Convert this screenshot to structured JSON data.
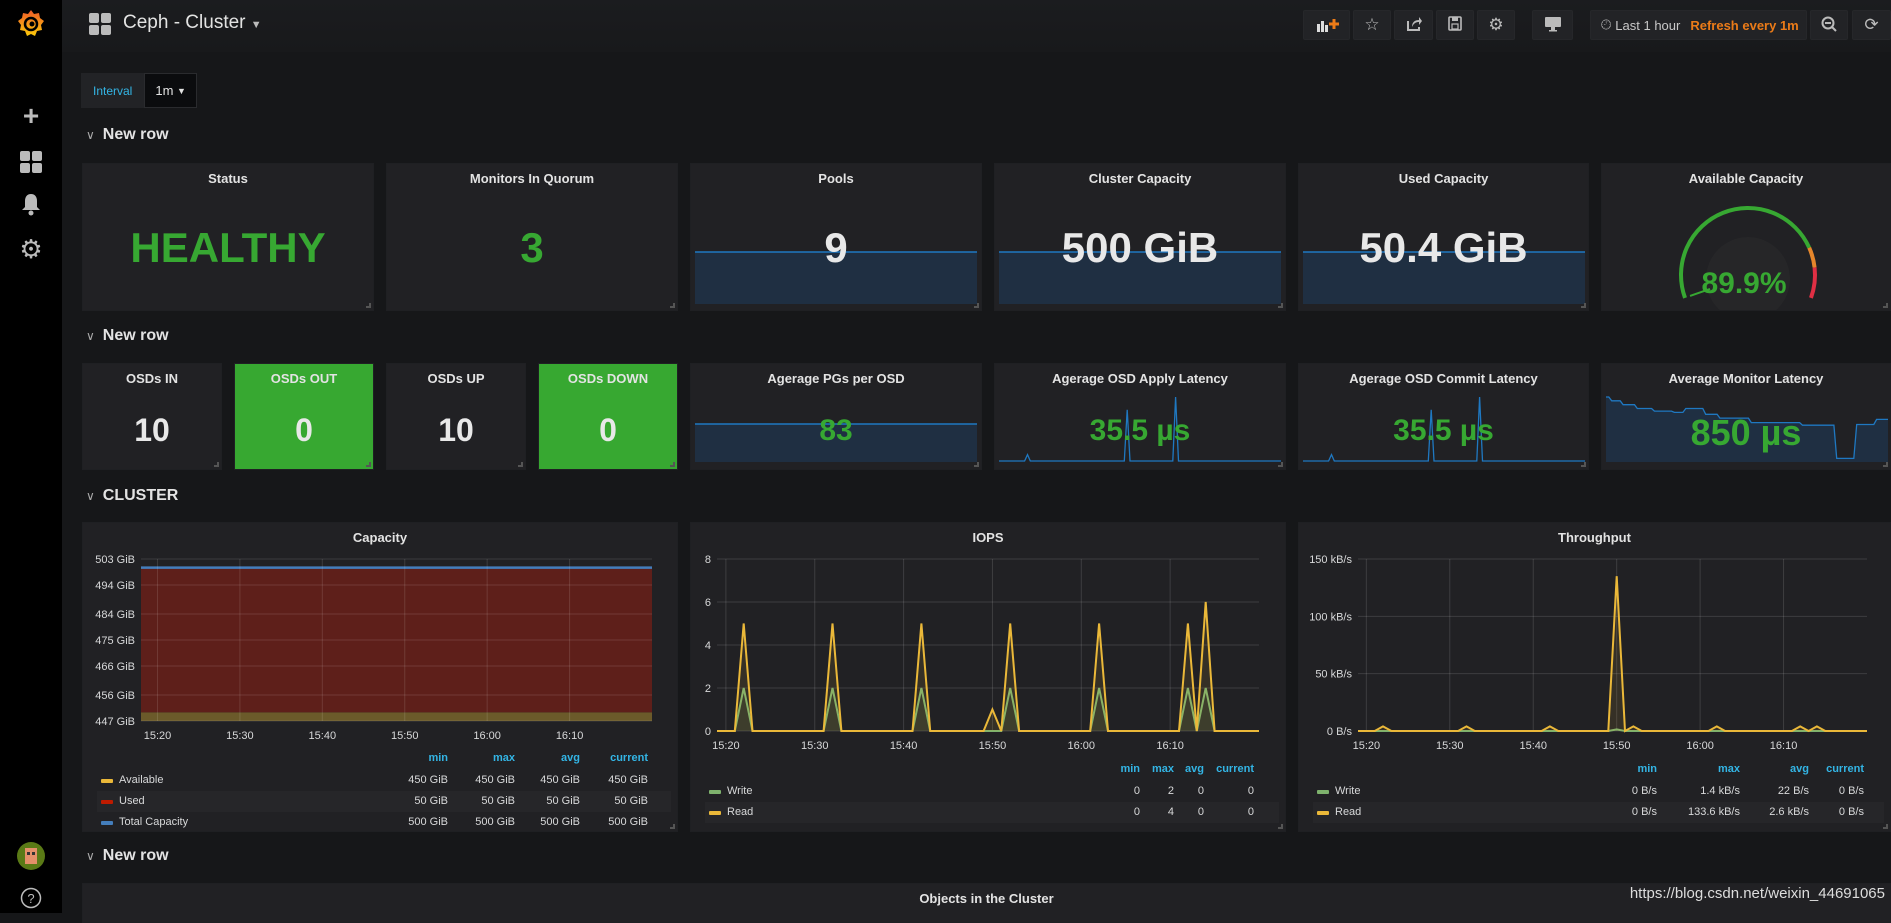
{
  "header": {
    "title": "Ceph - Cluster",
    "time_range": "Last 1 hour",
    "refresh": "Refresh every 1m"
  },
  "toolbar_icons": [
    "add-panel-icon",
    "star-icon",
    "share-icon",
    "save-icon",
    "gear-icon",
    "monitor-icon",
    "zoom-out-icon",
    "refresh-icon"
  ],
  "sidebar_icons": [
    "grafana-logo",
    "plus-icon",
    "dashboards-icon",
    "bell-icon",
    "gear-icon",
    "avatar",
    "help-icon"
  ],
  "variables": {
    "interval_label": "Interval",
    "interval_value": "1m"
  },
  "rows": [
    "New row",
    "New row",
    "CLUSTER",
    "New row"
  ],
  "colors": {
    "ok": "#37a832",
    "warn": "#e5862b",
    "crit": "#e02f44",
    "sparkline": "#1f78c1",
    "available": "#eab839",
    "used": "#bf1b00",
    "total": "#447ebc",
    "write": "#7eb26d",
    "read": "#eab839",
    "legend_header": "#33b5e5"
  },
  "stats_row1": [
    {
      "title": "Status",
      "value": "HEALTHY"
    },
    {
      "title": "Monitors In Quorum",
      "value": "3"
    },
    {
      "title": "Pools",
      "value": "9"
    },
    {
      "title": "Cluster Capacity",
      "value": "500 GiB"
    },
    {
      "title": "Used Capacity",
      "value": "50.4 GiB"
    },
    {
      "title": "Available Capacity",
      "value": "89.9%",
      "gauge_percent": 89.9,
      "thresholds": [
        80,
        88
      ]
    }
  ],
  "stats_row2": [
    {
      "title": "OSDs IN",
      "value": "10"
    },
    {
      "title": "OSDs OUT",
      "value": "0"
    },
    {
      "title": "OSDs UP",
      "value": "10"
    },
    {
      "title": "OSDs DOWN",
      "value": "0"
    },
    {
      "title": "Agerage PGs per OSD",
      "value": "83"
    },
    {
      "title": "Agerage OSD Apply Latency",
      "value": "35.5 µs"
    },
    {
      "title": "Agerage OSD Commit Latency",
      "value": "35.5 µs"
    },
    {
      "title": "Average Monitor Latency",
      "value": "850 µs"
    }
  ],
  "sparklines": {
    "apply": [
      0,
      0,
      0,
      0,
      0,
      0,
      0,
      0,
      0,
      0,
      1,
      0,
      0,
      0,
      0,
      0,
      0,
      0,
      0,
      0,
      0,
      0,
      0,
      0,
      0,
      0,
      0,
      0,
      0,
      0,
      0,
      0,
      0,
      0,
      0,
      0,
      0,
      0,
      0,
      0,
      0,
      0,
      0,
      0,
      0,
      8,
      0,
      0,
      0,
      0,
      0,
      0,
      0,
      0,
      0,
      0,
      0,
      0,
      0,
      0,
      0,
      0,
      10,
      0,
      0,
      0,
      0,
      0,
      0,
      0,
      0,
      0,
      0,
      0,
      0,
      0,
      0,
      0,
      0,
      0,
      0,
      0,
      0,
      0,
      0,
      0,
      0,
      0,
      0,
      0,
      0,
      0,
      0,
      0,
      0,
      0,
      0,
      0,
      0,
      0
    ],
    "commit": [
      0,
      0,
      0,
      0,
      0,
      0,
      0,
      0,
      0,
      0,
      1,
      0,
      0,
      0,
      0,
      0,
      0,
      0,
      0,
      0,
      0,
      0,
      0,
      0,
      0,
      0,
      0,
      0,
      0,
      0,
      0,
      0,
      0,
      0,
      0,
      0,
      0,
      0,
      0,
      0,
      0,
      0,
      0,
      0,
      0,
      8,
      0,
      0,
      0,
      0,
      0,
      0,
      0,
      0,
      0,
      0,
      0,
      0,
      0,
      0,
      0,
      0,
      10,
      0,
      0,
      0,
      0,
      0,
      0,
      0,
      0,
      0,
      0,
      0,
      0,
      0,
      0,
      0,
      0,
      0,
      0,
      0,
      0,
      0,
      0,
      0,
      0,
      0,
      0,
      0,
      0,
      0,
      0,
      0,
      0,
      0,
      0,
      0,
      0,
      0
    ],
    "monitor": [
      10,
      10,
      9.4,
      9.4,
      9.4,
      9.4,
      8.8,
      8.8,
      8.8,
      8.8,
      8.8,
      8.2,
      8.2,
      8.2,
      8.2,
      8.2,
      8.2,
      7.8,
      7.8,
      7.8,
      7.8,
      7.8,
      7.8,
      7.8,
      7.6,
      7.6,
      7.6,
      7.6,
      8.2,
      8.2,
      8.2,
      8.2,
      8.2,
      8.2,
      8.2,
      7.3,
      7.3,
      7.3,
      7.3,
      7.3,
      6.7,
      6.7,
      6.7,
      6.7,
      6.7,
      6.7,
      6.7,
      6.7,
      6.7,
      6.7,
      6.7,
      6.0,
      6.0,
      6.0,
      6.0,
      6.0,
      6.0,
      6.0,
      6.0,
      6.0,
      6.0,
      6.0,
      6.0,
      6.0,
      6.0,
      6.0,
      6.0,
      6.0,
      6.0,
      5.6,
      5.6,
      5.6,
      5.6,
      5.6,
      5.6,
      5.6,
      5.6,
      5.6,
      5.6,
      5.6,
      5.6,
      0.4,
      0.4,
      0.4,
      0.4,
      0.4,
      0.4,
      0.4,
      5.7,
      5.7,
      5.7,
      5.7,
      5.7,
      5.7,
      5.7,
      6.5,
      6.5,
      6.5,
      6.5,
      6.5
    ]
  },
  "chart_data": [
    {
      "type": "area",
      "title": "Capacity",
      "x_range": [
        "15:18",
        "16:20"
      ],
      "xticks": [
        "15:20",
        "15:30",
        "15:40",
        "15:50",
        "16:00",
        "16:10"
      ],
      "ylim": [
        447,
        503
      ],
      "yticks": [
        "447 GiB",
        "456 GiB",
        "466 GiB",
        "475 GiB",
        "484 GiB",
        "494 GiB",
        "503 GiB"
      ],
      "ytick_values": [
        447,
        456,
        466,
        475,
        484,
        494,
        503
      ],
      "stacked": true,
      "grid": true,
      "series": [
        {
          "name": "Available",
          "color": "#eab839",
          "x": [
            "15:18",
            "16:20"
          ],
          "y": [
            450,
            450
          ],
          "stats": [
            "450 GiB",
            "450 GiB",
            "450 GiB",
            "450 GiB"
          ]
        },
        {
          "name": "Used",
          "color": "#bf1b00",
          "x": [
            "15:18",
            "16:20"
          ],
          "y": [
            50,
            50
          ],
          "stats": [
            "50 GiB",
            "50 GiB",
            "50 GiB",
            "50 GiB"
          ]
        },
        {
          "name": "Total Capacity",
          "color": "#447ebc",
          "x": [
            "15:18",
            "16:20"
          ],
          "y": [
            500,
            500
          ],
          "stats": [
            "500 GiB",
            "500 GiB",
            "500 GiB",
            "500 GiB"
          ],
          "line_only": true
        }
      ],
      "legend_columns": [
        "min",
        "max",
        "avg",
        "current"
      ]
    },
    {
      "type": "line",
      "title": "IOPS",
      "x_range": [
        "15:19",
        "16:20"
      ],
      "xticks": [
        "15:20",
        "15:30",
        "15:40",
        "15:50",
        "16:00",
        "16:10"
      ],
      "ylim": [
        0,
        8
      ],
      "yticks": [
        "0",
        "2",
        "4",
        "6",
        "8"
      ],
      "ytick_values": [
        0,
        2,
        4,
        6,
        8
      ],
      "grid": true,
      "series": [
        {
          "name": "Write",
          "color": "#7eb26d",
          "x": [
            "15:19",
            "15:21",
            "15:22",
            "15:23",
            "15:31",
            "15:32",
            "15:33",
            "15:41",
            "15:42",
            "15:43",
            "15:51",
            "15:52",
            "15:53",
            "16:01",
            "16:02",
            "16:03",
            "16:11",
            "16:12",
            "16:13",
            "16:14",
            "16:15",
            "16:20"
          ],
          "y": [
            0,
            0,
            2,
            0,
            0,
            2,
            0,
            0,
            2,
            0,
            0,
            2,
            0,
            0,
            2,
            0,
            0,
            2,
            0,
            2,
            0,
            0
          ],
          "stats": [
            "0",
            "2",
            "0",
            "0"
          ]
        },
        {
          "name": "Read",
          "color": "#eab839",
          "x": [
            "15:19",
            "15:21",
            "15:22",
            "15:23",
            "15:31",
            "15:32",
            "15:33",
            "15:41",
            "15:42",
            "15:43",
            "15:49",
            "15:50",
            "15:51",
            "15:52",
            "15:53",
            "16:01",
            "16:02",
            "16:03",
            "16:11",
            "16:12",
            "16:13",
            "16:14",
            "16:15",
            "16:20"
          ],
          "y": [
            0,
            0,
            5,
            0,
            0,
            5,
            0,
            0,
            5,
            0,
            0,
            1,
            0,
            5,
            0,
            0,
            5,
            0,
            0,
            5,
            0,
            6,
            0,
            0
          ],
          "stats": [
            "0",
            "4",
            "0",
            "0"
          ]
        }
      ],
      "legend_columns": [
        "min",
        "max",
        "avg",
        "current"
      ]
    },
    {
      "type": "line",
      "title": "Throughput",
      "x_range": [
        "15:19",
        "16:20"
      ],
      "xticks": [
        "15:20",
        "15:30",
        "15:40",
        "15:50",
        "16:00",
        "16:10"
      ],
      "ylim": [
        0,
        150
      ],
      "yticks": [
        "0 B/s",
        "50 kB/s",
        "100 kB/s",
        "150 kB/s"
      ],
      "ytick_values": [
        0,
        50,
        100,
        150
      ],
      "grid": true,
      "series": [
        {
          "name": "Write",
          "color": "#7eb26d",
          "x": [
            "15:19",
            "15:49",
            "15:50",
            "15:51",
            "16:20"
          ],
          "y": [
            0,
            0,
            1.4,
            0,
            0
          ],
          "stats": [
            "0 B/s",
            "1.4 kB/s",
            "22 B/s",
            "0 B/s"
          ]
        },
        {
          "name": "Read",
          "color": "#eab839",
          "x": [
            "15:19",
            "15:21",
            "15:22",
            "15:23",
            "15:31",
            "15:32",
            "15:33",
            "15:41",
            "15:42",
            "15:43",
            "15:49",
            "15:50",
            "15:51",
            "15:52",
            "15:53",
            "16:01",
            "16:02",
            "16:03",
            "16:11",
            "16:12",
            "16:13",
            "16:14",
            "16:15",
            "16:20"
          ],
          "y": [
            0,
            0,
            4,
            0,
            0,
            4,
            0,
            0,
            4,
            0,
            0,
            135,
            0,
            4,
            0,
            0,
            4,
            0,
            0,
            4,
            0,
            4,
            0,
            0
          ],
          "stats": [
            "0 B/s",
            "133.6 kB/s",
            "2.6 kB/s",
            "0 B/s"
          ]
        }
      ],
      "legend_columns": [
        "min",
        "max",
        "avg",
        "current"
      ]
    }
  ],
  "bottom_panel": {
    "title": "Objects in the Cluster"
  },
  "watermark": "https://blog.csdn.net/weixin_44691065"
}
